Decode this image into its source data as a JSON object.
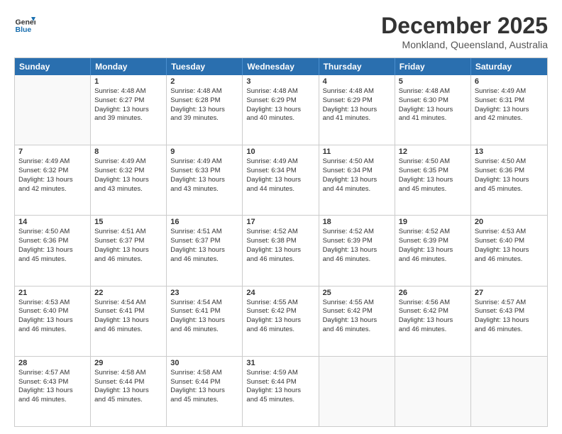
{
  "header": {
    "logo_line1": "General",
    "logo_line2": "Blue",
    "month": "December 2025",
    "location": "Monkland, Queensland, Australia"
  },
  "weekdays": [
    "Sunday",
    "Monday",
    "Tuesday",
    "Wednesday",
    "Thursday",
    "Friday",
    "Saturday"
  ],
  "rows": [
    [
      {
        "day": "",
        "empty": true
      },
      {
        "day": "1",
        "l1": "Sunrise: 4:48 AM",
        "l2": "Sunset: 6:27 PM",
        "l3": "Daylight: 13 hours",
        "l4": "and 39 minutes."
      },
      {
        "day": "2",
        "l1": "Sunrise: 4:48 AM",
        "l2": "Sunset: 6:28 PM",
        "l3": "Daylight: 13 hours",
        "l4": "and 39 minutes."
      },
      {
        "day": "3",
        "l1": "Sunrise: 4:48 AM",
        "l2": "Sunset: 6:29 PM",
        "l3": "Daylight: 13 hours",
        "l4": "and 40 minutes."
      },
      {
        "day": "4",
        "l1": "Sunrise: 4:48 AM",
        "l2": "Sunset: 6:29 PM",
        "l3": "Daylight: 13 hours",
        "l4": "and 41 minutes."
      },
      {
        "day": "5",
        "l1": "Sunrise: 4:48 AM",
        "l2": "Sunset: 6:30 PM",
        "l3": "Daylight: 13 hours",
        "l4": "and 41 minutes."
      },
      {
        "day": "6",
        "l1": "Sunrise: 4:49 AM",
        "l2": "Sunset: 6:31 PM",
        "l3": "Daylight: 13 hours",
        "l4": "and 42 minutes."
      }
    ],
    [
      {
        "day": "7",
        "l1": "Sunrise: 4:49 AM",
        "l2": "Sunset: 6:32 PM",
        "l3": "Daylight: 13 hours",
        "l4": "and 42 minutes."
      },
      {
        "day": "8",
        "l1": "Sunrise: 4:49 AM",
        "l2": "Sunset: 6:32 PM",
        "l3": "Daylight: 13 hours",
        "l4": "and 43 minutes."
      },
      {
        "day": "9",
        "l1": "Sunrise: 4:49 AM",
        "l2": "Sunset: 6:33 PM",
        "l3": "Daylight: 13 hours",
        "l4": "and 43 minutes."
      },
      {
        "day": "10",
        "l1": "Sunrise: 4:49 AM",
        "l2": "Sunset: 6:34 PM",
        "l3": "Daylight: 13 hours",
        "l4": "and 44 minutes."
      },
      {
        "day": "11",
        "l1": "Sunrise: 4:50 AM",
        "l2": "Sunset: 6:34 PM",
        "l3": "Daylight: 13 hours",
        "l4": "and 44 minutes."
      },
      {
        "day": "12",
        "l1": "Sunrise: 4:50 AM",
        "l2": "Sunset: 6:35 PM",
        "l3": "Daylight: 13 hours",
        "l4": "and 45 minutes."
      },
      {
        "day": "13",
        "l1": "Sunrise: 4:50 AM",
        "l2": "Sunset: 6:36 PM",
        "l3": "Daylight: 13 hours",
        "l4": "and 45 minutes."
      }
    ],
    [
      {
        "day": "14",
        "l1": "Sunrise: 4:50 AM",
        "l2": "Sunset: 6:36 PM",
        "l3": "Daylight: 13 hours",
        "l4": "and 45 minutes."
      },
      {
        "day": "15",
        "l1": "Sunrise: 4:51 AM",
        "l2": "Sunset: 6:37 PM",
        "l3": "Daylight: 13 hours",
        "l4": "and 46 minutes."
      },
      {
        "day": "16",
        "l1": "Sunrise: 4:51 AM",
        "l2": "Sunset: 6:37 PM",
        "l3": "Daylight: 13 hours",
        "l4": "and 46 minutes."
      },
      {
        "day": "17",
        "l1": "Sunrise: 4:52 AM",
        "l2": "Sunset: 6:38 PM",
        "l3": "Daylight: 13 hours",
        "l4": "and 46 minutes."
      },
      {
        "day": "18",
        "l1": "Sunrise: 4:52 AM",
        "l2": "Sunset: 6:39 PM",
        "l3": "Daylight: 13 hours",
        "l4": "and 46 minutes."
      },
      {
        "day": "19",
        "l1": "Sunrise: 4:52 AM",
        "l2": "Sunset: 6:39 PM",
        "l3": "Daylight: 13 hours",
        "l4": "and 46 minutes."
      },
      {
        "day": "20",
        "l1": "Sunrise: 4:53 AM",
        "l2": "Sunset: 6:40 PM",
        "l3": "Daylight: 13 hours",
        "l4": "and 46 minutes."
      }
    ],
    [
      {
        "day": "21",
        "l1": "Sunrise: 4:53 AM",
        "l2": "Sunset: 6:40 PM",
        "l3": "Daylight: 13 hours",
        "l4": "and 46 minutes."
      },
      {
        "day": "22",
        "l1": "Sunrise: 4:54 AM",
        "l2": "Sunset: 6:41 PM",
        "l3": "Daylight: 13 hours",
        "l4": "and 46 minutes."
      },
      {
        "day": "23",
        "l1": "Sunrise: 4:54 AM",
        "l2": "Sunset: 6:41 PM",
        "l3": "Daylight: 13 hours",
        "l4": "and 46 minutes."
      },
      {
        "day": "24",
        "l1": "Sunrise: 4:55 AM",
        "l2": "Sunset: 6:42 PM",
        "l3": "Daylight: 13 hours",
        "l4": "and 46 minutes."
      },
      {
        "day": "25",
        "l1": "Sunrise: 4:55 AM",
        "l2": "Sunset: 6:42 PM",
        "l3": "Daylight: 13 hours",
        "l4": "and 46 minutes."
      },
      {
        "day": "26",
        "l1": "Sunrise: 4:56 AM",
        "l2": "Sunset: 6:42 PM",
        "l3": "Daylight: 13 hours",
        "l4": "and 46 minutes."
      },
      {
        "day": "27",
        "l1": "Sunrise: 4:57 AM",
        "l2": "Sunset: 6:43 PM",
        "l3": "Daylight: 13 hours",
        "l4": "and 46 minutes."
      }
    ],
    [
      {
        "day": "28",
        "l1": "Sunrise: 4:57 AM",
        "l2": "Sunset: 6:43 PM",
        "l3": "Daylight: 13 hours",
        "l4": "and 46 minutes."
      },
      {
        "day": "29",
        "l1": "Sunrise: 4:58 AM",
        "l2": "Sunset: 6:44 PM",
        "l3": "Daylight: 13 hours",
        "l4": "and 45 minutes."
      },
      {
        "day": "30",
        "l1": "Sunrise: 4:58 AM",
        "l2": "Sunset: 6:44 PM",
        "l3": "Daylight: 13 hours",
        "l4": "and 45 minutes."
      },
      {
        "day": "31",
        "l1": "Sunrise: 4:59 AM",
        "l2": "Sunset: 6:44 PM",
        "l3": "Daylight: 13 hours",
        "l4": "and 45 minutes."
      },
      {
        "day": "",
        "empty": true
      },
      {
        "day": "",
        "empty": true
      },
      {
        "day": "",
        "empty": true
      }
    ]
  ]
}
